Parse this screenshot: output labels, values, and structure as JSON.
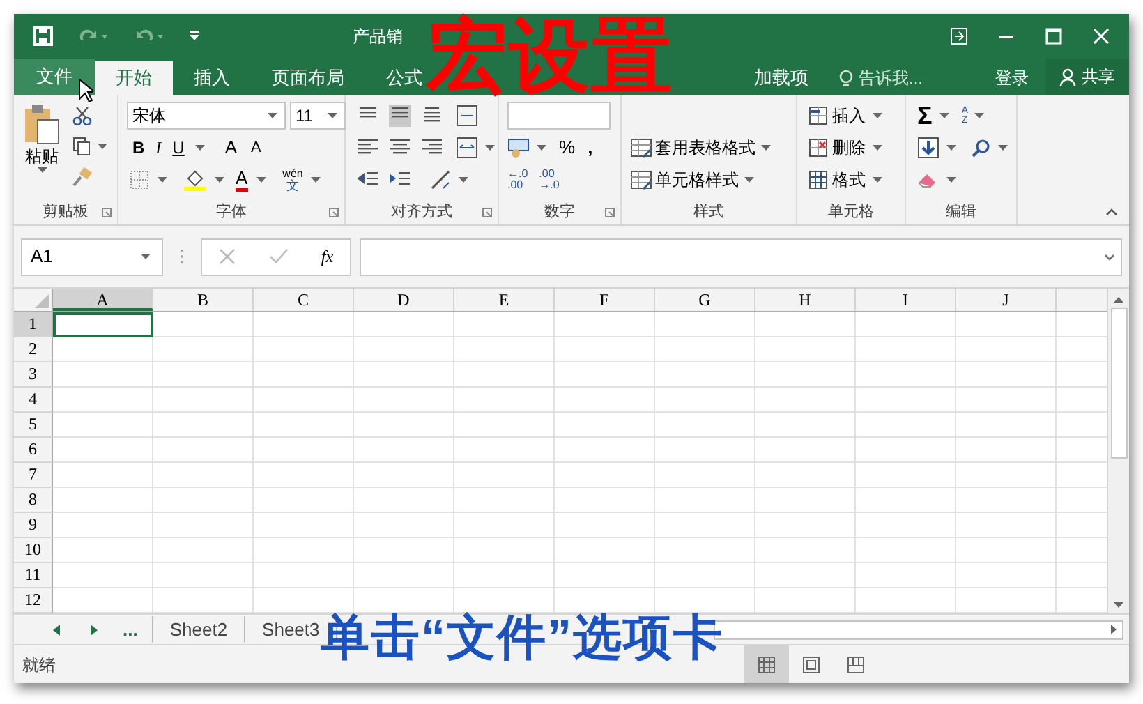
{
  "window": {
    "title": "产品销"
  },
  "tabs": [
    {
      "label": "文件",
      "selected": false,
      "kind": "file"
    },
    {
      "label": "开始",
      "selected": true,
      "kind": "tab"
    },
    {
      "label": "插入",
      "selected": false,
      "kind": "tab"
    },
    {
      "label": "页面布局",
      "selected": false,
      "kind": "tab"
    },
    {
      "label": "公式",
      "selected": false,
      "kind": "tab"
    }
  ],
  "more_tabs": [
    {
      "label": "加载项",
      "selected": false
    }
  ],
  "tell_me": {
    "placeholder": "告诉我..."
  },
  "sign_in": "登录",
  "share": "共享",
  "ribbon": {
    "clipboard": {
      "paste": "粘贴",
      "label": "剪贴板"
    },
    "font": {
      "name": "宋体",
      "size": "11",
      "bold": "B",
      "italic": "I",
      "underline": "U",
      "grow": "A",
      "shrink": "A",
      "font_color": "A",
      "phonetic": [
        "wén",
        "文"
      ],
      "label": "字体"
    },
    "alignment": {
      "label": "对齐方式"
    },
    "number": {
      "percent": "%",
      "comma": ",",
      "increase_decimal": [
        "←.0",
        ".00"
      ],
      "decrease_decimal": [
        ".00",
        "→.0"
      ],
      "label": "数字"
    },
    "styles": {
      "items": [
        "套用表格格式",
        "单元格样式"
      ],
      "label": "样式"
    },
    "cells": {
      "items": [
        "插入",
        "删除",
        "格式"
      ],
      "label": "单元格"
    },
    "editing": {
      "sum": "Σ",
      "sort": [
        "A",
        "Z"
      ],
      "label": "编辑"
    }
  },
  "formula_bar": {
    "name_box": "A1",
    "fx": "fx"
  },
  "grid": {
    "columns": [
      {
        "label": "A",
        "selected": true
      },
      {
        "label": "B",
        "selected": false
      },
      {
        "label": "C",
        "selected": false
      },
      {
        "label": "D",
        "selected": false
      },
      {
        "label": "E",
        "selected": false
      },
      {
        "label": "F",
        "selected": false
      },
      {
        "label": "G",
        "selected": false
      },
      {
        "label": "H",
        "selected": false
      },
      {
        "label": "I",
        "selected": false
      },
      {
        "label": "J",
        "selected": false
      }
    ],
    "rows": [
      {
        "label": "1",
        "selected": true
      },
      {
        "label": "2",
        "selected": false
      },
      {
        "label": "3",
        "selected": false
      },
      {
        "label": "4",
        "selected": false
      },
      {
        "label": "5",
        "selected": false
      },
      {
        "label": "6",
        "selected": false
      },
      {
        "label": "7",
        "selected": false
      },
      {
        "label": "8",
        "selected": false
      },
      {
        "label": "9",
        "selected": false
      },
      {
        "label": "10",
        "selected": false
      },
      {
        "label": "11",
        "selected": false
      },
      {
        "label": "12",
        "selected": false
      }
    ]
  },
  "sheet_tabs": {
    "more": "...",
    "tabs": [
      {
        "label": "Sheet2",
        "selected": false
      },
      {
        "label": "Sheet3",
        "selected": false
      }
    ]
  },
  "status_bar": {
    "text": "就绪",
    "views": [
      {
        "kind": "normal",
        "selected": true
      },
      {
        "kind": "page_layout",
        "selected": false
      },
      {
        "kind": "page_break",
        "selected": false
      }
    ]
  },
  "annotations": [
    {
      "kind": "heading",
      "text": "宏设置"
    },
    {
      "kind": "caption",
      "text": "单击“文件”选项卡"
    }
  ]
}
